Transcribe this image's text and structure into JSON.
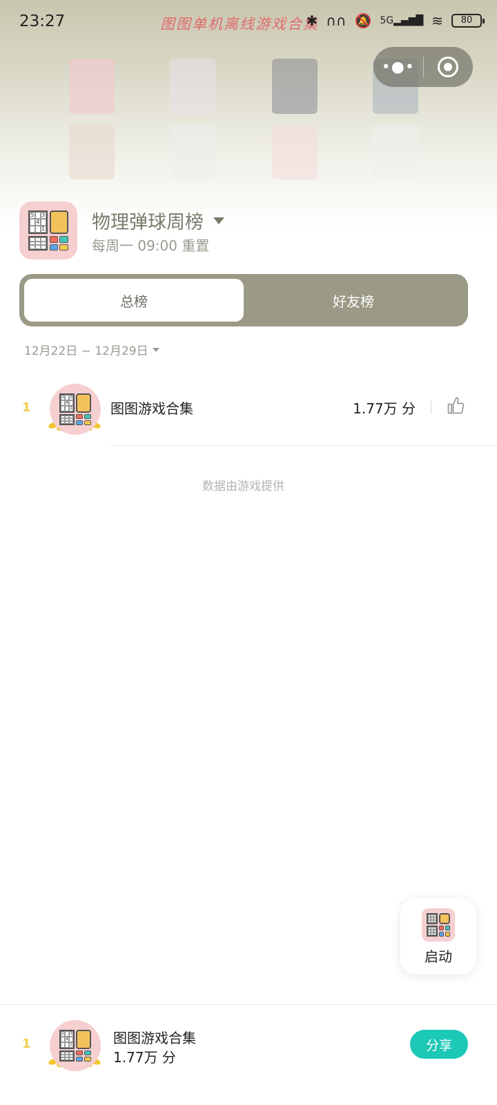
{
  "status_bar": {
    "time": "23:27",
    "watermark": "图图单机离线游戏合集",
    "network": "5G",
    "battery": "80"
  },
  "capsule": {
    "more_icon": "more-dots-icon",
    "close_icon": "target-close-icon"
  },
  "header": {
    "title": "物理弹球周榜",
    "reset_text": "每周一 09:00 重置"
  },
  "tabs": [
    {
      "label": "总榜",
      "active": true
    },
    {
      "label": "好友榜",
      "active": false
    }
  ],
  "date_range": "12月22日 ~ 12月29日",
  "ranking": [
    {
      "rank": "1",
      "name": "图图游戏合集",
      "score": "1.77万 分"
    }
  ],
  "provider_note": "数据由游戏提供",
  "launch": {
    "label": "启动"
  },
  "my_rank": {
    "rank": "1",
    "name": "图图游戏合集",
    "score": "1.77万 分",
    "share_label": "分享"
  },
  "colors": {
    "accent": "#1cc8b6",
    "segment_bg": "#9b9a86",
    "rank_gold": "#f0cc4a",
    "logo_bg": "#f6cfd1"
  }
}
